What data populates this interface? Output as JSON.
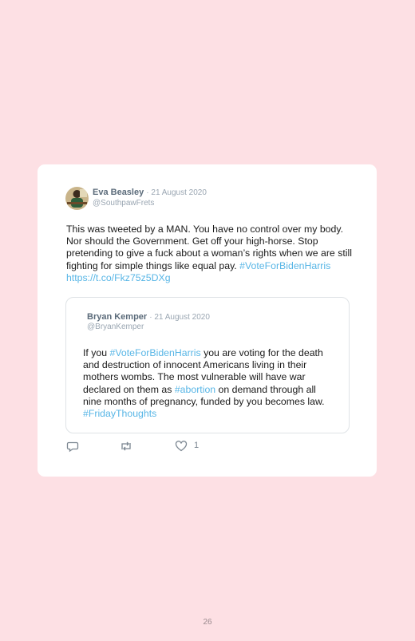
{
  "tweet": {
    "author_name": "Eva Beasley",
    "date": "· 21 August 2020",
    "handle": "@SouthpawFrets",
    "text_main": "This was tweeted by a MAN. You have no control over my body. Nor should the Government. Get off your high-horse. Stop pretending to give a fuck about a woman’s rights when we are still fighting for simple things like equal pay. ",
    "hashtag": "#VoteForBidenHarris",
    "link": "https://t.co/Fkz75z5DXg"
  },
  "quoted_tweet": {
    "author_name": "Bryan Kemper",
    "date": "· 21 August 2020",
    "handle": "@BryanKemper",
    "text_1": "If you ",
    "hashtag_1": "#VoteForBidenHarris",
    "text_2": " you are voting for the death and destruction of innocent Americans living in their mothers wombs. The most vulnerable will have war declared on them as ",
    "hashtag_2": "#abortion",
    "text_3": " on demand through all nine months of pregnancy, funded by you becomes law. ",
    "hashtag_3": "#FridayThoughts"
  },
  "actions": {
    "reply_icon": "reply-icon",
    "retweet_icon": "retweet-icon",
    "like_icon": "heart-icon",
    "like_count": "1"
  },
  "page": {
    "number": "26"
  },
  "colors": {
    "background": "#fde0e4",
    "hashtag": "#58b6e6",
    "name": "#5b6b7a"
  }
}
